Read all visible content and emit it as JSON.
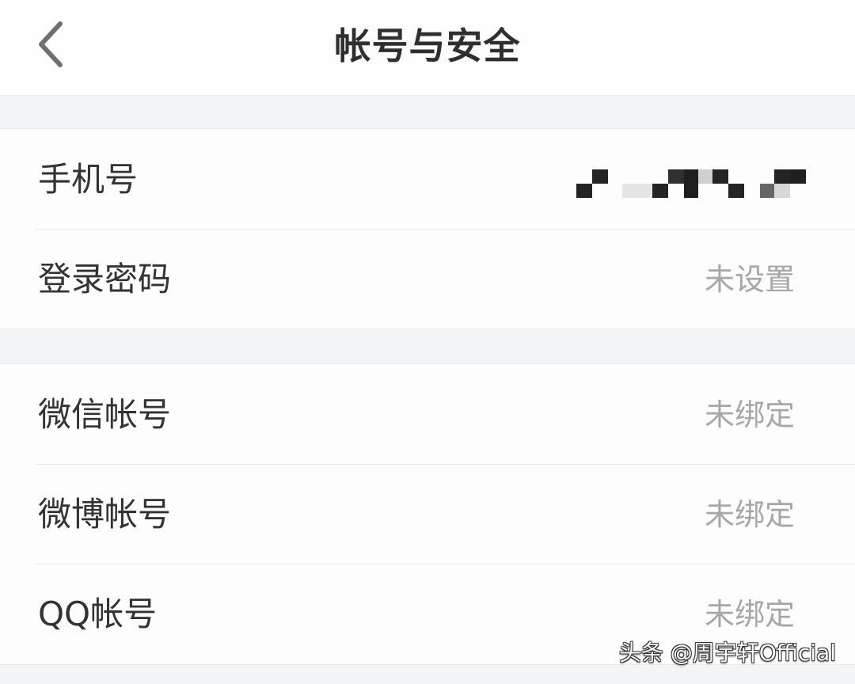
{
  "navbar": {
    "title": "帐号与安全",
    "back_icon": "chevron-left-icon"
  },
  "sections": [
    {
      "rows": [
        {
          "label": "手机号",
          "value": "",
          "value_state": "masked"
        },
        {
          "label": "登录密码",
          "value": "未设置"
        }
      ]
    },
    {
      "rows": [
        {
          "label": "微信帐号",
          "value": "未绑定"
        },
        {
          "label": "微博帐号",
          "value": "未绑定"
        },
        {
          "label": "QQ帐号",
          "value": "未绑定"
        }
      ]
    }
  ],
  "watermark": {
    "text": "头条 @周宇轩Official"
  },
  "colors": {
    "background": "#f3f4f6",
    "surface": "#fdfdfd",
    "label_text": "#333333",
    "value_text": "#a7a7a7",
    "divider": "#e8e9eb",
    "mask_dark": "#222222",
    "mask_light": "#d7d7d7"
  }
}
